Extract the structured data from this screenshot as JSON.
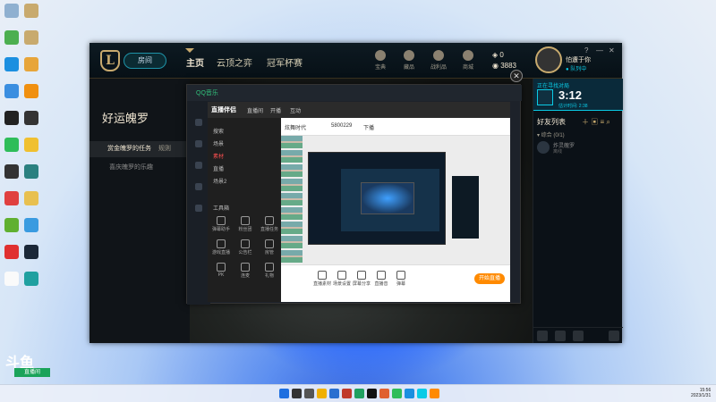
{
  "desktop": {
    "icons": [
      {
        "label": "Recycle",
        "color": "#8fb0d0"
      },
      {
        "label": "League",
        "color": "#c8aa6e"
      },
      {
        "label": "NVIDIA",
        "color": "#4caf50"
      },
      {
        "label": "League",
        "color": "#c8aa6e"
      },
      {
        "label": "Edge",
        "color": "#1b8fe0"
      },
      {
        "label": "Folder",
        "color": "#e7a53a"
      },
      {
        "label": "Cloud",
        "color": "#3a8ee0"
      },
      {
        "label": "Help",
        "color": "#f09010"
      },
      {
        "label": "QQ",
        "color": "#222"
      },
      {
        "label": "Ring",
        "color": "#333"
      },
      {
        "label": "WeChat",
        "color": "#2ebd59"
      },
      {
        "label": "Smile",
        "color": "#f0c030"
      },
      {
        "label": "App",
        "color": "#333"
      },
      {
        "label": "Circle",
        "color": "#2a8080"
      },
      {
        "label": "Game",
        "color": "#e04040"
      },
      {
        "label": "Folder",
        "color": "#e8c050"
      },
      {
        "label": "Star",
        "color": "#60b030"
      },
      {
        "label": "Net",
        "color": "#3a9be0"
      },
      {
        "label": "Music",
        "color": "#e03030"
      },
      {
        "label": "Steam",
        "color": "#1b2838"
      },
      {
        "label": "Doc",
        "color": "#fafafa"
      },
      {
        "label": "Play",
        "color": "#20a0a0"
      }
    ]
  },
  "client": {
    "play_label": "房间",
    "nav": [
      "主页",
      "云顶之弈",
      "冠军杯赛"
    ],
    "top_icons": [
      "宝典",
      "藏品",
      "战利品",
      "商城"
    ],
    "currency": {
      "rp": "0",
      "be": "3883"
    },
    "profile": {
      "name": "怕遭于你",
      "status": "● 队列中"
    },
    "window_controls": [
      "?",
      "—",
      "✕"
    ],
    "left_panel": {
      "title": "好运魄罗",
      "item_active": "赏金魄罗的任务",
      "item_active_suffix": "规则",
      "item_other": "喜庆魄罗的乐趣"
    },
    "side": {
      "queue_label": "正在寻找对局",
      "timer": "3:12",
      "queue_sub": "估计时间: 2:38",
      "friends_title": "好友列表",
      "group": "▾ 综合 (0/1)",
      "friend": {
        "name": "炸灵魄罗",
        "status": "离线"
      }
    }
  },
  "qqmusic": {
    "logo": "QQ音乐",
    "close_label": "✕"
  },
  "live": {
    "logo": "直播伴侣",
    "nav": [
      "直播间",
      "开播",
      "互动"
    ],
    "tabs": [
      "炫舞时代",
      "5800229",
      "下播"
    ],
    "left_items": [
      "搜索",
      "场景",
      "素材",
      "直播",
      "场景2"
    ],
    "tools_label": "工具箱",
    "tools": [
      "弹幕助手",
      "粉丝团",
      "直播任务",
      "游戏直播",
      "公告栏",
      "房管",
      "PK",
      "连麦",
      "礼物"
    ],
    "footer": [
      "直播素材",
      "场景设置",
      "屏幕分享",
      "直播音",
      "弹幕"
    ],
    "go_live": "开始直播"
  },
  "watermark": {
    "logo": "斗鱼",
    "text": "直播间"
  },
  "taskbar": {
    "icons": [
      "#1f6fe0",
      "#333",
      "#555",
      "#f0b000",
      "#2a6fd0",
      "#c0392b",
      "#20a060",
      "#111",
      "#e06030",
      "#2ebd59",
      "#1b8fe0",
      "#0acbe6",
      "#ff8a00"
    ],
    "clock": [
      "15:56",
      "2023/1/31"
    ]
  }
}
